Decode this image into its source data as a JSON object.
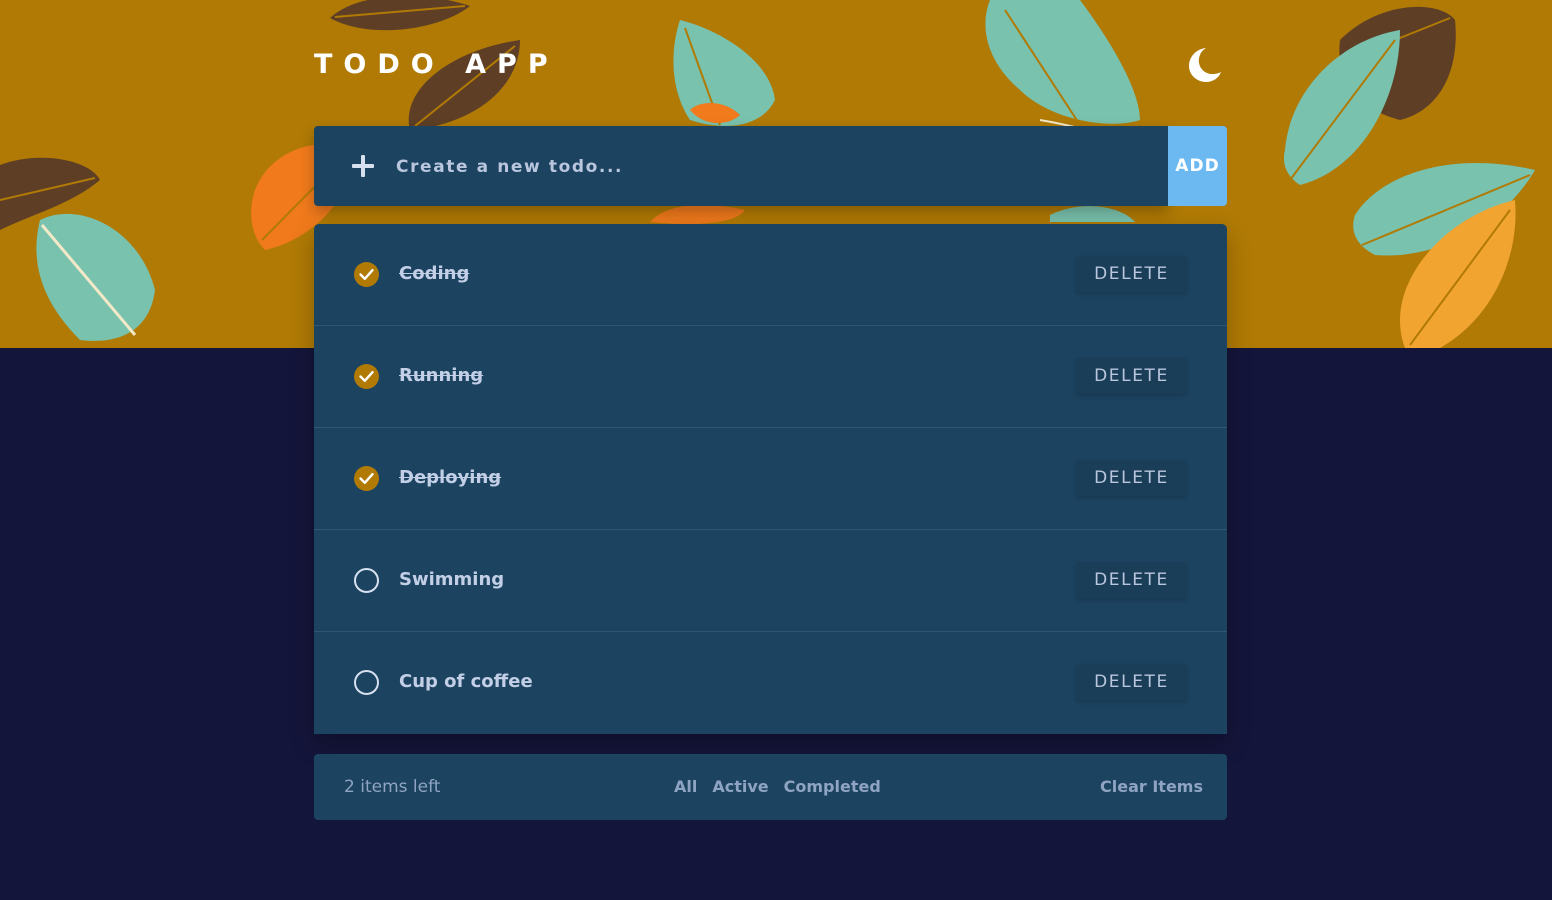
{
  "header": {
    "title": "TODO APP",
    "theme_toggle_icon": "moon-icon"
  },
  "new_todo": {
    "placeholder": "Create a new todo...",
    "value": "",
    "add_icon": "plus-icon",
    "add_label": "ADD"
  },
  "todos": [
    {
      "label": "Coding",
      "completed": true,
      "delete_label": "DELETE"
    },
    {
      "label": "Running",
      "completed": true,
      "delete_label": "DELETE"
    },
    {
      "label": "Deploying",
      "completed": true,
      "delete_label": "DELETE"
    },
    {
      "label": "Swimming",
      "completed": false,
      "delete_label": "DELETE"
    },
    {
      "label": "Cup of coffee",
      "completed": false,
      "delete_label": "DELETE"
    }
  ],
  "footer": {
    "items_left": "2 items left",
    "filters": [
      "All",
      "Active",
      "Completed"
    ],
    "clear_label": "Clear Items"
  },
  "colors": {
    "hero_background": "#b07a05",
    "page_background": "#14153a",
    "card_background": "#1c4360",
    "add_button": "#6cb9f2",
    "check_fill": "#b07a05",
    "leaf_teal": "#79c2ad",
    "leaf_brown": "#5e3f26",
    "leaf_orange": "#f07a1c",
    "leaf_yellow": "#f2a431"
  }
}
